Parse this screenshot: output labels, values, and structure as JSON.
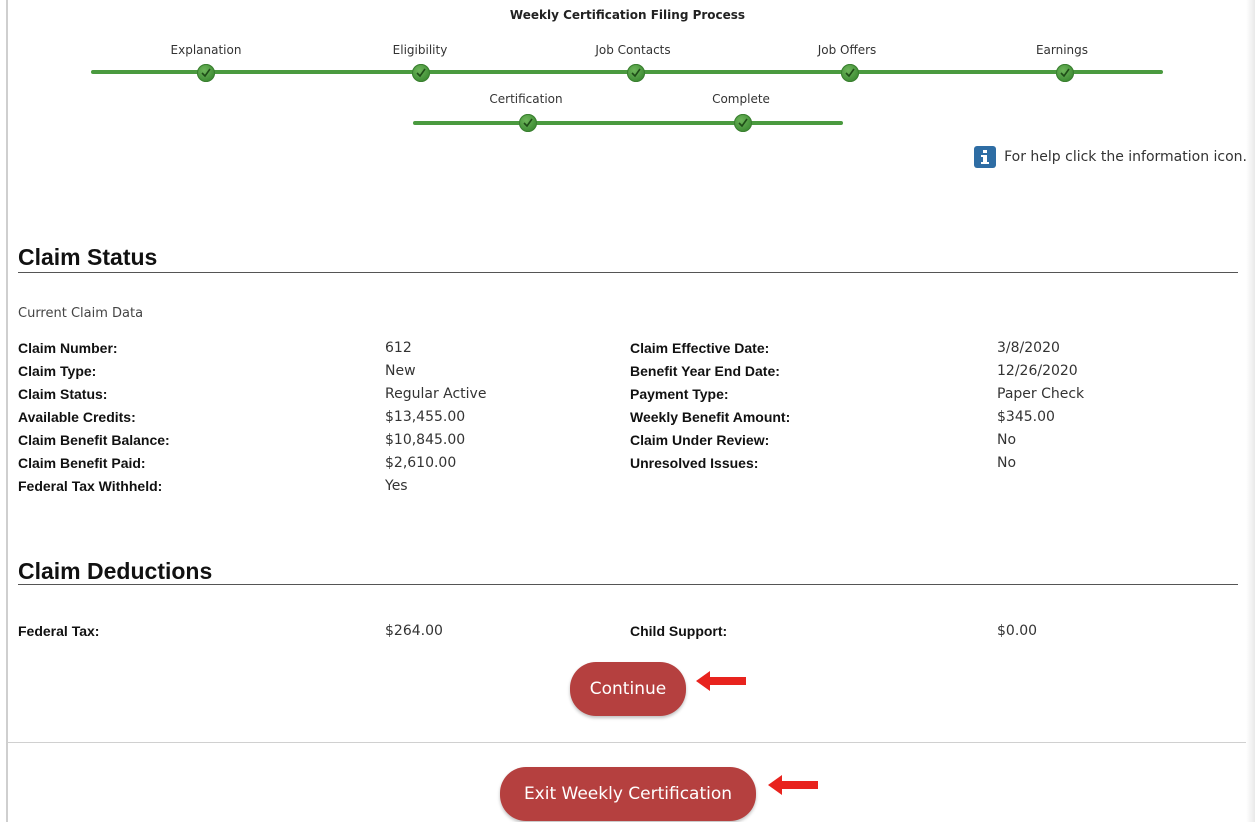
{
  "process": {
    "title": "Weekly Certification Filing Process",
    "row1": [
      "Explanation",
      "Eligibility",
      "Job Contacts",
      "Job Offers",
      "Earnings"
    ],
    "row2": [
      "Certification",
      "Complete"
    ],
    "completed_color": "#4a9a3f"
  },
  "help": {
    "text": "For help click the information icon.",
    "icon": "info-icon"
  },
  "claim_status": {
    "heading": "Claim Status",
    "caption": "Current Claim Data",
    "left": [
      {
        "label": "Claim Number:",
        "value": "612"
      },
      {
        "label": "Claim Type:",
        "value": "New"
      },
      {
        "label": "Claim Status:",
        "value": "Regular Active"
      },
      {
        "label": "Available Credits:",
        "value": "$13,455.00"
      },
      {
        "label": "Claim Benefit Balance:",
        "value": "$10,845.00"
      },
      {
        "label": "Claim Benefit Paid:",
        "value": "$2,610.00"
      },
      {
        "label": "Federal Tax Withheld:",
        "value": "Yes"
      }
    ],
    "right": [
      {
        "label": "Claim Effective Date:",
        "value": "3/8/2020"
      },
      {
        "label": "Benefit Year End Date:",
        "value": "12/26/2020"
      },
      {
        "label": "Payment Type:",
        "value": "Paper Check"
      },
      {
        "label": "Weekly Benefit Amount:",
        "value": "$345.00"
      },
      {
        "label": "Claim Under Review:",
        "value": "No"
      },
      {
        "label": "Unresolved Issues:",
        "value": "No"
      }
    ]
  },
  "claim_deductions": {
    "heading": "Claim Deductions",
    "left": {
      "label": "Federal Tax:",
      "value": "$264.00"
    },
    "right": {
      "label": "Child Support:",
      "value": "$0.00"
    }
  },
  "buttons": {
    "continue": "Continue",
    "exit": "Exit Weekly Certification",
    "color": "#b5403f"
  },
  "annotation": {
    "arrow_color": "#e8231e"
  }
}
